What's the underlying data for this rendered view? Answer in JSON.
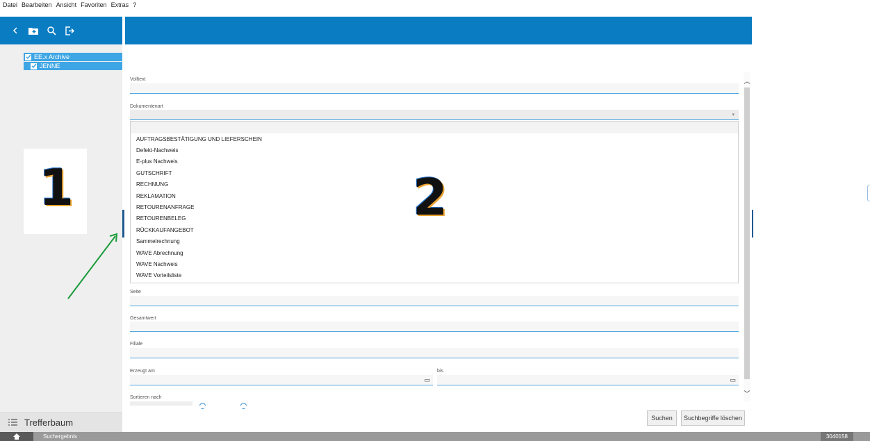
{
  "menu": {
    "items": [
      "Datei",
      "Bearbeiten",
      "Ansicht",
      "Favoriten",
      "Extras",
      "?"
    ]
  },
  "sidebar": {
    "icons": [
      "chevron-left-icon",
      "folder-add-icon",
      "search-icon",
      "logout-icon"
    ],
    "tree": [
      {
        "label": "EE.x Archive",
        "checked": true
      },
      {
        "label": "JENNE",
        "checked": true
      }
    ],
    "bottom_label": "Trefferbaum",
    "bottom_icon": "list-icon"
  },
  "annotations": {
    "left_number": "1",
    "main_number": "2"
  },
  "form": {
    "volltext_label": "Volltext",
    "volltext_value": "",
    "dokumentenart_label": "Dokumentenart",
    "dokumentenart_value": "",
    "dokumentenart_options": [
      "AUFTRAGSBESTÄTIGUNG UND LIEFERSCHEIN",
      "Defekt-Nachweis",
      "E-plus Nachweis",
      "GUTSCHRIFT",
      "RECHNUNG",
      "REKLAMATION",
      "RETOURENANFRAGE",
      "RETOURENBELEG",
      "RÜCKKAUFANGEBOT",
      "Sammelrechnung",
      "WAVE Abrechnung",
      "WAVE Nachweis",
      "WAVE Vorteilsliste"
    ],
    "seite_label": "Seite",
    "gesamtwert_label": "Gesamtwert",
    "filiale_label": "Filiale",
    "erzeugt_am_label": "Erzeugt am",
    "bis_label": "bis",
    "sortieren_label": "Sortieren nach"
  },
  "buttons": {
    "suchen": "Suchen",
    "suchbegriffe_loeschen": "Suchbegriffe löschen"
  },
  "statusbar": {
    "tab_label": "Suchergebnis",
    "number": "3040158"
  },
  "colors": {
    "header_blue": "#0a7cc2",
    "tree_selected": "#3fa6e5",
    "field_underline": "#4aa3df",
    "annotation_arrow": "#1a9a3a"
  }
}
